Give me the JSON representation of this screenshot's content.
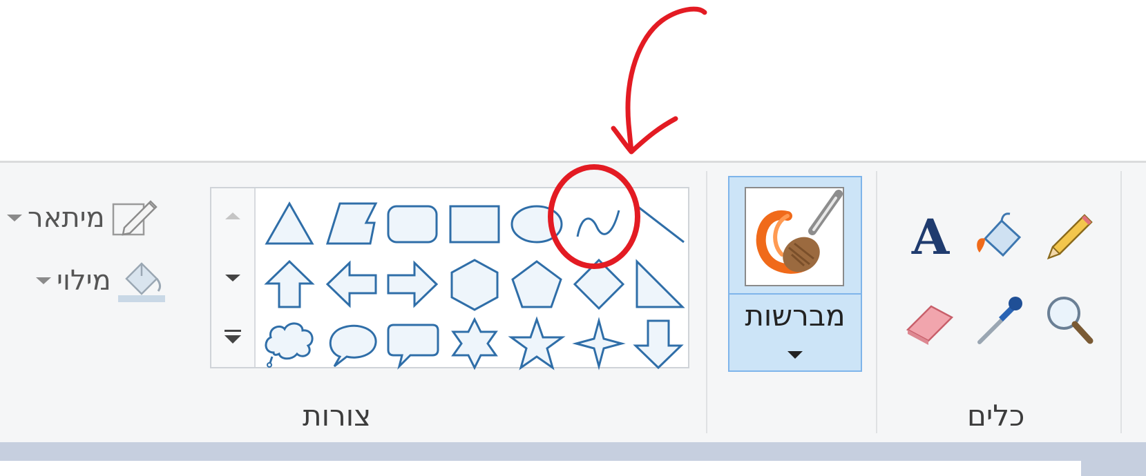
{
  "ribbon": {
    "outline_label": "מיתאר",
    "fill_label": "מילוי",
    "shapes_group_label": "צורות",
    "brushes_label": "מברשות",
    "tools_group_label": "כלים"
  },
  "shapes": [
    {
      "name": "triangle-shape-icon"
    },
    {
      "name": "trapezoid-shape-icon"
    },
    {
      "name": "rounded-rectangle-shape-icon"
    },
    {
      "name": "rectangle-shape-icon"
    },
    {
      "name": "oval-shape-icon"
    },
    {
      "name": "curve-shape-icon"
    },
    {
      "name": "line-shape-icon"
    },
    {
      "name": "up-arrow-shape-icon"
    },
    {
      "name": "left-arrow-shape-icon"
    },
    {
      "name": "right-arrow-shape-icon"
    },
    {
      "name": "hexagon-shape-icon"
    },
    {
      "name": "pentagon-shape-icon"
    },
    {
      "name": "diamond-shape-icon"
    },
    {
      "name": "right-triangle-shape-icon"
    },
    {
      "name": "cloud-callout-shape-icon"
    },
    {
      "name": "oval-callout-shape-icon"
    },
    {
      "name": "rect-callout-shape-icon"
    },
    {
      "name": "six-point-star-shape-icon"
    },
    {
      "name": "five-point-star-shape-icon"
    },
    {
      "name": "four-point-star-shape-icon"
    },
    {
      "name": "down-arrow-shape-icon"
    }
  ],
  "colors": {
    "shape_stroke": "#2f6ea8",
    "annotation_red": "#e31b23",
    "brush_selected_bg": "#cce4f7"
  }
}
